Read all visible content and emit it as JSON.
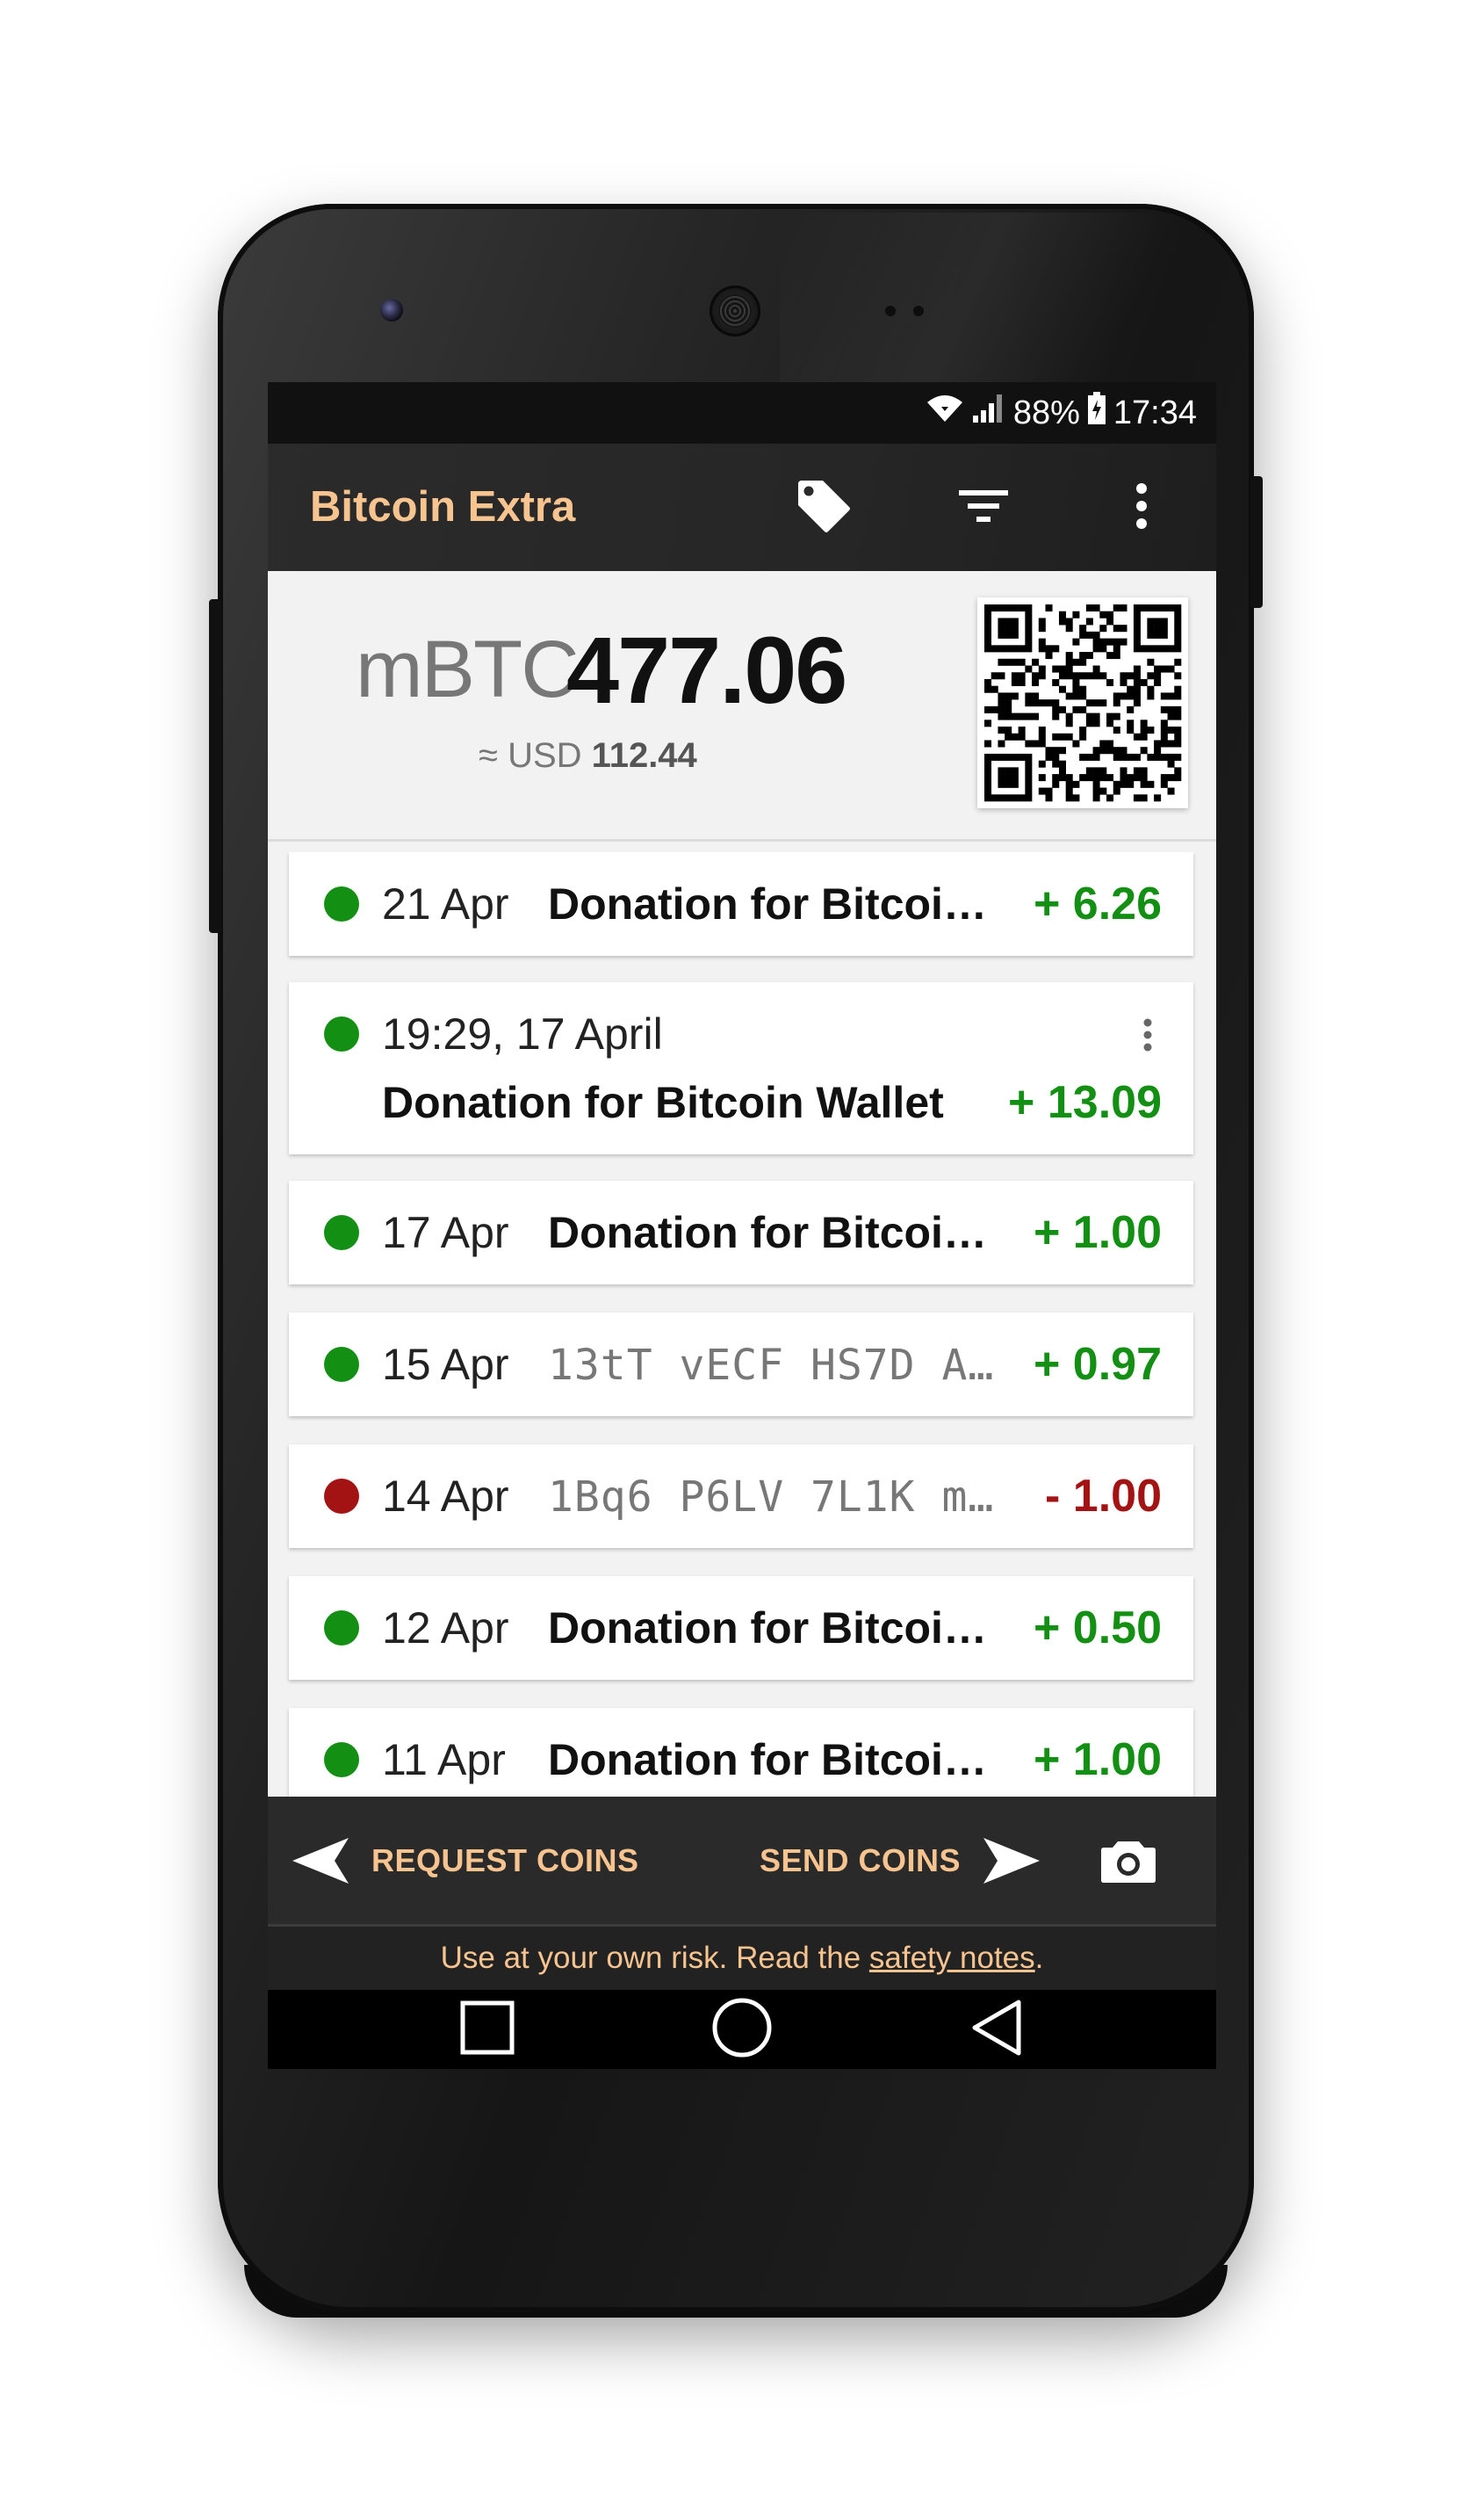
{
  "status_bar": {
    "battery_percent": "88%",
    "time": "17:34"
  },
  "app_bar": {
    "title": "Bitcoin Extra",
    "icons": [
      "tag-icon",
      "filter-icon",
      "more-vert-icon"
    ]
  },
  "balance": {
    "unit": "mBTC",
    "amount": "477.06",
    "fiat_prefix": "≈ USD",
    "fiat_amount": "112.44"
  },
  "transactions": [
    {
      "date": "21 Apr",
      "label": "Donation for Bitcoi…",
      "value": "+ 6.26",
      "status": "received"
    },
    {
      "date": "19:29, 17 April",
      "label": "Donation for Bitcoin Wallet",
      "value": "+ 13.09",
      "status": "received",
      "expanded": true
    },
    {
      "date": "17 Apr",
      "label": "Donation for Bitcoi…",
      "value": "+ 1.00",
      "status": "received"
    },
    {
      "date": "15 Apr",
      "address": "13tT vECF HS7D A…",
      "value": "+ 0.97",
      "status": "received"
    },
    {
      "date": "14 Apr",
      "address": "1Bq6 P6LV 7L1K m…",
      "value": "- 1.00",
      "status": "sent"
    },
    {
      "date": "12 Apr",
      "label": "Donation for Bitcoi…",
      "value": "+ 0.50",
      "status": "received"
    },
    {
      "date": "11 Apr",
      "label": "Donation for Bitcoi…",
      "value": "+ 1.00",
      "status": "received"
    }
  ],
  "actions": {
    "request_label": "REQUEST COINS",
    "send_label": "SEND COINS"
  },
  "notice": {
    "text": "Use at your own risk. Read the ",
    "link": "safety notes",
    "suffix": "."
  },
  "colors": {
    "accent": "#f7c48f",
    "received": "#138f13",
    "sent": "#a31313",
    "app_bar": "#2a2a2a"
  }
}
